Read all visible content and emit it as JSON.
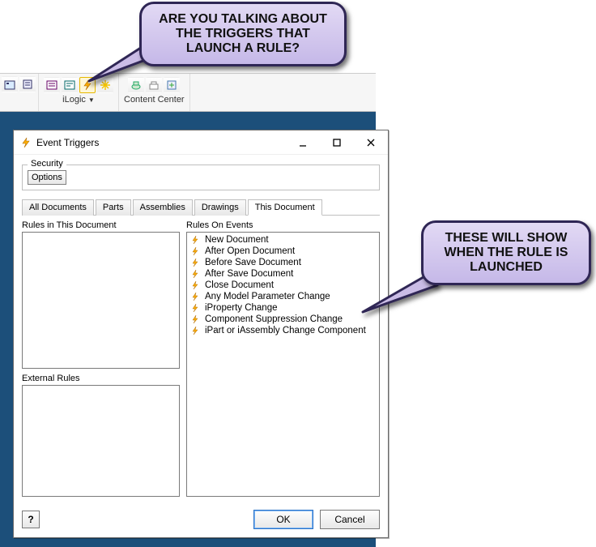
{
  "ribbon": {
    "panels": {
      "ilogic": {
        "label": "iLogic"
      },
      "contentcenter": {
        "label": "Content Center"
      }
    }
  },
  "dialog": {
    "title": "Event Triggers",
    "security": {
      "legend": "Security",
      "optionsLabel": "Options"
    },
    "tabs": {
      "alldocs": "All Documents",
      "parts": "Parts",
      "assemblies": "Assemblies",
      "drawings": "Drawings",
      "thisdoc": "This Document"
    },
    "labels": {
      "rulesInDoc": "Rules in This Document",
      "externalRules": "External Rules",
      "rulesOnEvents": "Rules On Events"
    },
    "events": [
      "New Document",
      "After Open Document",
      "Before Save Document",
      "After Save Document",
      "Close Document",
      "Any Model Parameter Change",
      "iProperty Change",
      "Component Suppression Change",
      "iPart or iAssembly Change Component"
    ],
    "buttons": {
      "ok": "OK",
      "cancel": "Cancel",
      "help": "?"
    }
  },
  "callouts": {
    "top": "ARE YOU TALKING ABOUT THE TRIGGERS THAT LAUNCH A RULE?",
    "right": "THESE WILL SHOW WHEN THE RULE IS LAUNCHED"
  }
}
